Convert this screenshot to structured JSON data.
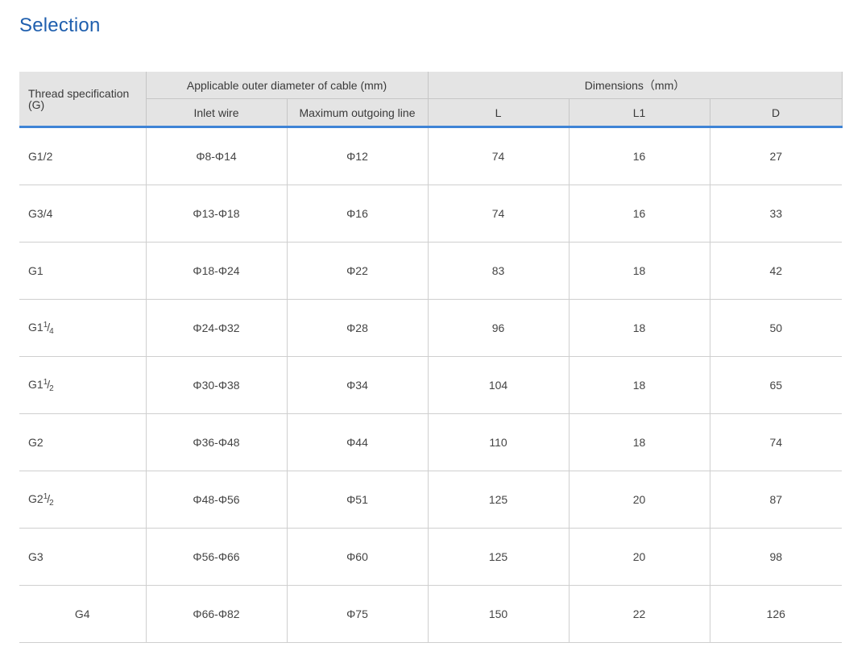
{
  "title": "Selection",
  "table": {
    "header": {
      "thread": "Thread specification (G)",
      "cable_group": "Applicable outer diameter of cable (mm)",
      "dimensions_group": "Dimensions（mm）",
      "inlet": "Inlet wire",
      "max_outgoing": "Maximum outgoing line",
      "L": "L",
      "L1": "L1",
      "D": "D"
    },
    "rows": [
      {
        "thread_base": "G1/2",
        "thread_num": "",
        "thread_den": "",
        "inlet": "Φ8-Φ14",
        "max_out": "Φ12",
        "L": "74",
        "L1": "16",
        "D": "27"
      },
      {
        "thread_base": "G3/4",
        "thread_num": "",
        "thread_den": "",
        "inlet": "Φ13-Φ18",
        "max_out": "Φ16",
        "L": "74",
        "L1": "16",
        "D": "33"
      },
      {
        "thread_base": "G1",
        "thread_num": "",
        "thread_den": "",
        "inlet": "Φ18-Φ24",
        "max_out": "Φ22",
        "L": "83",
        "L1": "18",
        "D": "42"
      },
      {
        "thread_base": "G1",
        "thread_num": "1",
        "thread_den": "4",
        "inlet": "Φ24-Φ32",
        "max_out": "Φ28",
        "L": "96",
        "L1": "18",
        "D": "50"
      },
      {
        "thread_base": "G1",
        "thread_num": "1",
        "thread_den": "2",
        "inlet": "Φ30-Φ38",
        "max_out": "Φ34",
        "L": "104",
        "L1": "18",
        "D": "65"
      },
      {
        "thread_base": "G2",
        "thread_num": "",
        "thread_den": "",
        "inlet": "Φ36-Φ48",
        "max_out": "Φ44",
        "L": "110",
        "L1": "18",
        "D": "74"
      },
      {
        "thread_base": "G2",
        "thread_num": "1",
        "thread_den": "2",
        "inlet": "Φ48-Φ56",
        "max_out": "Φ51",
        "L": "125",
        "L1": "20",
        "D": "87"
      },
      {
        "thread_base": "G3",
        "thread_num": "",
        "thread_den": "",
        "inlet": "Φ56-Φ66",
        "max_out": "Φ60",
        "L": "125",
        "L1": "20",
        "D": "98"
      },
      {
        "thread_base": "G4",
        "thread_num": "",
        "thread_den": "",
        "inlet": "Φ66-Φ82",
        "max_out": "Φ75",
        "L": "150",
        "L1": "22",
        "D": "126"
      }
    ]
  }
}
